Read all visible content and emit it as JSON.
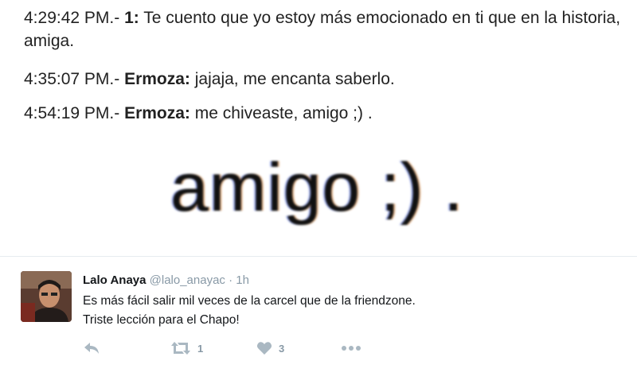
{
  "chat": {
    "line1": {
      "time": "4:29:42 PM.- ",
      "sender": "1:",
      "message": " Te cuento que yo estoy más emocionado en ti que en la historia, amiga."
    },
    "line2": {
      "time": "4:35:07 PM.- ",
      "sender": "Ermoza:",
      "message": " jajaja, me encanta saberlo."
    },
    "line3": {
      "time": "4:54:19 PM.- ",
      "sender": "Ermoza:",
      "message": " me chiveaste, amigo ;) ."
    },
    "zoom": "amigo ;) ."
  },
  "tweet": {
    "name": "Lalo Anaya",
    "handle": "@lalo_anayac",
    "separator": " · ",
    "time": "1h",
    "line1": "Es más fácil salir mil veces de la carcel que de la friendzone.",
    "line2": "Triste lección para el Chapo!",
    "retweet_count": "1",
    "like_count": "3"
  },
  "icons": [
    "reply-icon",
    "retweet-icon",
    "like-icon",
    "more-icon"
  ],
  "colors": {
    "icon_gray": "#aab8c2",
    "muted_text": "#8899a6",
    "name_text": "#14171a"
  }
}
